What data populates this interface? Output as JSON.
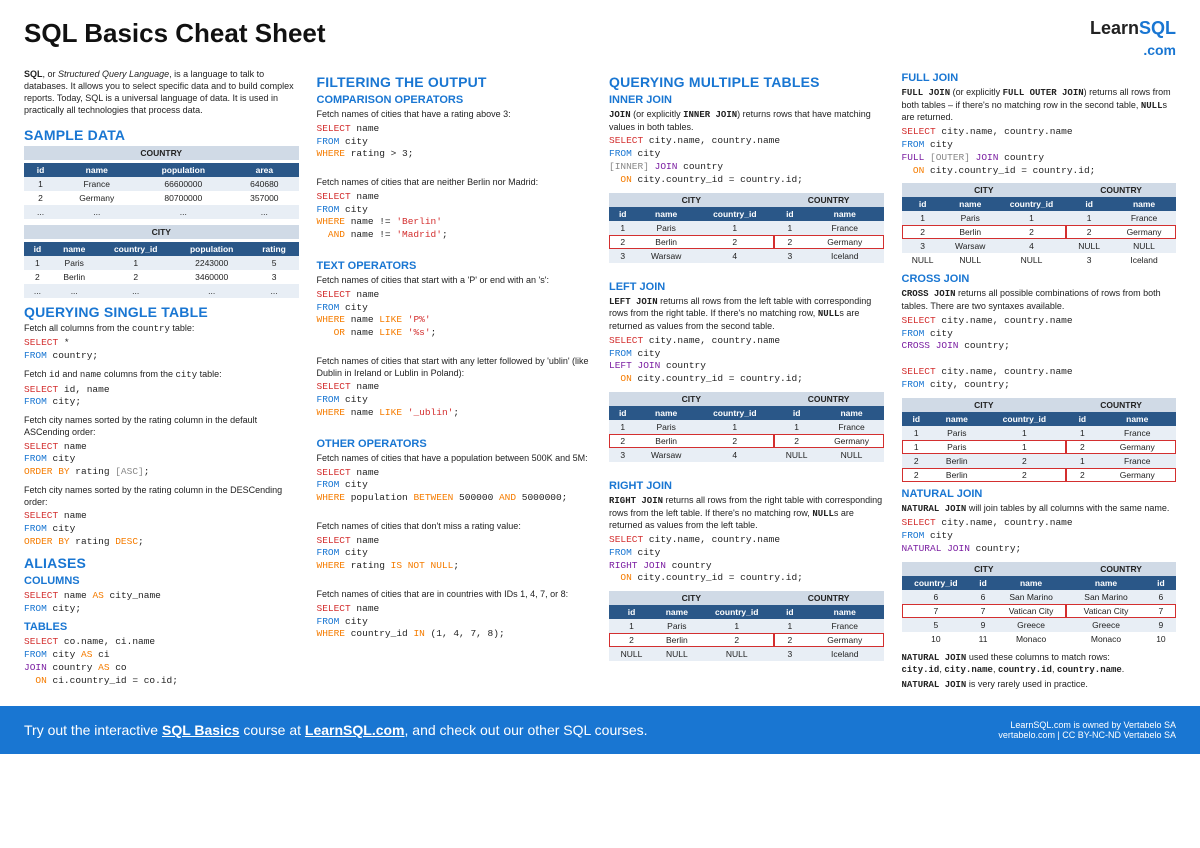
{
  "title": "SQL Basics Cheat Sheet",
  "logo": {
    "brand": "Learn",
    "suffix": "SQL",
    "domain": ".com"
  },
  "intro": {
    "t1": "SQL",
    "t2": ", or ",
    "t3": "Structured Query Language",
    "t4": ", is a language to talk to databases. It allows you to select specific data and to build complex reports. Today, SQL is a universal language of data. It is used in practically all technologies that process data."
  },
  "s": {
    "sample": "SAMPLE DATA",
    "country": "COUNTRY",
    "city": "CITY",
    "c_h": [
      "id",
      "name",
      "population",
      "area"
    ],
    "c_r": [
      [
        "1",
        "France",
        "66600000",
        "640680"
      ],
      [
        "2",
        "Germany",
        "80700000",
        "357000"
      ],
      [
        "...",
        "...",
        "...",
        "..."
      ]
    ],
    "ci_h": [
      "id",
      "name",
      "country_id",
      "population",
      "rating"
    ],
    "ci_r": [
      [
        "1",
        "Paris",
        "1",
        "2243000",
        "5"
      ],
      [
        "2",
        "Berlin",
        "2",
        "3460000",
        "3"
      ],
      [
        "...",
        "...",
        "...",
        "...",
        "..."
      ]
    ],
    "qst": "QUERYING SINGLE TABLE",
    "d1": "Fetch all columns from the country table:",
    "d2": "Fetch id and name columns from the city table:",
    "d3": "Fetch city names sorted by the rating column in the default ASCending order:",
    "d4": "Fetch city names sorted by the rating column in the DESCending order:",
    "aliases": "ALIASES",
    "cols": "COLUMNS",
    "tables": "TABLES"
  },
  "filt": {
    "h": "FILTERING THE OUTPUT",
    "comp": "COMPARISON OPERATORS",
    "txt": "TEXT OPERATORS",
    "oth": "OTHER OPERATORS",
    "d1": "Fetch names of cities that have a rating above 3:",
    "d2": "Fetch names of cities that are neither Berlin nor Madrid:",
    "d3": "Fetch names of cities that start with a 'P' or end with an 's':",
    "d4": "Fetch names of cities that start with any letter followed by 'ublin' (like Dublin in Ireland or Lublin in Poland):",
    "d5": "Fetch names of cities that have a population between 500K and 5M:",
    "d6": "Fetch names of cities that don't miss a rating value:",
    "d7": "Fetch names of cities that are in countries with IDs 1, 4, 7, or 8:"
  },
  "mult": {
    "h": "QUERYING MULTIPLE TABLES",
    "ij": "INNER JOIN",
    "lj": "LEFT JOIN",
    "rj": "RIGHT JOIN",
    "d1a": "JOIN",
    "d1b": " (or explicitly ",
    "d1c": "INNER JOIN",
    "d1d": ") returns rows that have matching values in both tables.",
    "d2a": "LEFT JOIN",
    "d2b": " returns all rows from the left table with corresponding rows from the right table. If there's no matching row, ",
    "d2c": "NULL",
    "d2d": "s are returned as values from the second table.",
    "d3a": "RIGHT JOIN",
    "d3b": " returns all rows from the right table with corresponding rows from the left table. If there's no matching row, ",
    "d3c": "NULL",
    "d3d": "s are returned as values from the left table.",
    "jh": [
      "id",
      "name",
      "country_id",
      "id",
      "name"
    ],
    "ij_r": [
      [
        "1",
        "Paris",
        "1",
        "1",
        "France"
      ],
      [
        "2",
        "Berlin",
        "2",
        "2",
        "Germany"
      ],
      [
        "3",
        "Warsaw",
        "4",
        "3",
        "Iceland"
      ]
    ],
    "lj_r": [
      [
        "1",
        "Paris",
        "1",
        "1",
        "France"
      ],
      [
        "2",
        "Berlin",
        "2",
        "2",
        "Germany"
      ],
      [
        "3",
        "Warsaw",
        "4",
        "NULL",
        "NULL"
      ]
    ],
    "rj_r": [
      [
        "1",
        "Paris",
        "1",
        "1",
        "France"
      ],
      [
        "2",
        "Berlin",
        "2",
        "2",
        "Germany"
      ],
      [
        "NULL",
        "NULL",
        "NULL",
        "3",
        "Iceland"
      ]
    ]
  },
  "fj": {
    "h": "FULL JOIN",
    "cj": "CROSS JOIN",
    "nj": "NATURAL JOIN",
    "d1a": "FULL JOIN",
    "d1b": " (or explicitly ",
    "d1c": "FULL OUTER JOIN",
    "d1d": ") returns all rows from both tables – if there's no matching row in the second table, ",
    "d1e": "NULL",
    "d1f": "s are returned.",
    "d2a": "CROSS JOIN",
    "d2b": " returns all possible combinations of rows from both tables. There are two syntaxes available.",
    "d3a": "NATURAL JOIN",
    "d3b": " will join tables by all columns with the same name.",
    "d4a": "NATURAL JOIN",
    "d4b": " used these columns to match rows:",
    "d4c": "city.id",
    "d4d": "city.name",
    "d4e": "country.id",
    "d4f": "country.name",
    "d5a": "NATURAL JOIN",
    "d5b": " is very rarely used in practice.",
    "fj_r": [
      [
        "1",
        "Paris",
        "1",
        "1",
        "France"
      ],
      [
        "2",
        "Berlin",
        "2",
        "2",
        "Germany"
      ],
      [
        "3",
        "Warsaw",
        "4",
        "NULL",
        "NULL"
      ],
      [
        "NULL",
        "NULL",
        "NULL",
        "3",
        "Iceland"
      ]
    ],
    "cj_r": [
      [
        "1",
        "Paris",
        "1",
        "1",
        "France"
      ],
      [
        "1",
        "Paris",
        "1",
        "2",
        "Germany"
      ],
      [
        "2",
        "Berlin",
        "2",
        "1",
        "France"
      ],
      [
        "2",
        "Berlin",
        "2",
        "2",
        "Germany"
      ]
    ],
    "nj_h": [
      "country_id",
      "id",
      "name",
      "name",
      "id"
    ],
    "nj_r": [
      [
        "6",
        "6",
        "San Marino",
        "San Marino",
        "6"
      ],
      [
        "7",
        "7",
        "Vatican City",
        "Vatican City",
        "7"
      ],
      [
        "5",
        "9",
        "Greece",
        "Greece",
        "9"
      ],
      [
        "10",
        "11",
        "Monaco",
        "Monaco",
        "10"
      ]
    ]
  },
  "footer": {
    "left1": "Try out the interactive ",
    "left2": "SQL Basics",
    "left3": " course at ",
    "left4": "LearnSQL.com",
    "left5": ", and check out our other SQL courses.",
    "r1": "LearnSQL.com is owned by Vertabelo SA",
    "r2": "vertabelo.com | CC BY-NC-ND Vertabelo SA"
  }
}
